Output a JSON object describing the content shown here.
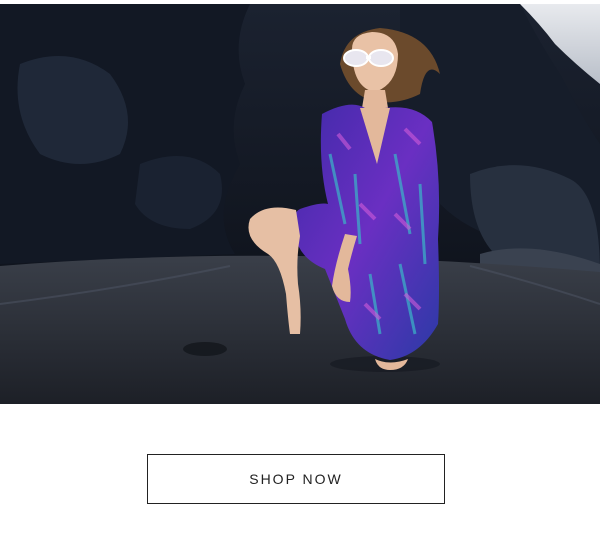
{
  "hero": {
    "image_subject": "model-in-floral-dress-kneeling-on-black-sand-beach"
  },
  "cta": {
    "label": "SHOP NOW"
  },
  "colors": {
    "button_border": "#222222",
    "button_text": "#222222",
    "background": "#ffffff",
    "dress": "#5a2bb8"
  }
}
